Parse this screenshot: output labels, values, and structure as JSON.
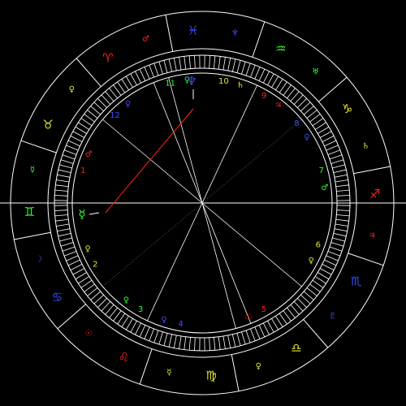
{
  "colors": {
    "background": "#000000",
    "lines": "#ffffff",
    "aspect_line": "#888888",
    "red": "#ff2020",
    "green": "#30ff30",
    "yellow": "#e6e630",
    "blue": "#3b4dff"
  },
  "zodiac_signs": [
    {
      "glyph": "♈",
      "color": "#ff2020"
    },
    {
      "glyph": "♉",
      "color": "#e6e630"
    },
    {
      "glyph": "♊",
      "color": "#30ff30"
    },
    {
      "glyph": "♋",
      "color": "#3b4dff"
    },
    {
      "glyph": "♌",
      "color": "#ff2020"
    },
    {
      "glyph": "♍",
      "color": "#e6e630"
    },
    {
      "glyph": "♎",
      "color": "#e6e630"
    },
    {
      "glyph": "♏",
      "color": "#3b4dff"
    },
    {
      "glyph": "♐",
      "color": "#ff2020"
    },
    {
      "glyph": "♑",
      "color": "#e6e630"
    },
    {
      "glyph": "♒",
      "color": "#30ff30"
    },
    {
      "glyph": "♓",
      "color": "#3b4dff"
    }
  ],
  "sign_rulers": [
    {
      "glyph": "♂",
      "color": "#ff2020"
    },
    {
      "glyph": "♀",
      "color": "#e6e630"
    },
    {
      "glyph": "☿",
      "color": "#30ff30"
    },
    {
      "glyph": "☽",
      "color": "#3b4dff"
    },
    {
      "glyph": "☉",
      "color": "#ff2020"
    },
    {
      "glyph": "☿",
      "color": "#e6e630"
    },
    {
      "glyph": "♀",
      "color": "#e6e630"
    },
    {
      "glyph": "♇",
      "color": "#3b4dff"
    },
    {
      "glyph": "♃",
      "color": "#ff2020"
    },
    {
      "glyph": "♄",
      "color": "#e6e630"
    },
    {
      "glyph": "♅",
      "color": "#30ff30"
    },
    {
      "glyph": "♆",
      "color": "#3b4dff"
    }
  ],
  "houses": [
    {
      "number": "1",
      "color": "#ff2020"
    },
    {
      "number": "2",
      "color": "#e6e630"
    },
    {
      "number": "3",
      "color": "#30ff30"
    },
    {
      "number": "4",
      "color": "#3b4dff"
    },
    {
      "number": "5",
      "color": "#ff2020"
    },
    {
      "number": "6",
      "color": "#e6e630"
    },
    {
      "number": "7",
      "color": "#30ff30"
    },
    {
      "number": "8",
      "color": "#3b4dff"
    },
    {
      "number": "9",
      "color": "#ff2020"
    },
    {
      "number": "10",
      "color": "#e6e630"
    },
    {
      "number": "11",
      "color": "#30ff30"
    },
    {
      "number": "12",
      "color": "#3b4dff"
    }
  ],
  "house_rulers": [
    {
      "glyph": "♂",
      "color": "#ff2020"
    },
    {
      "glyph": "♀",
      "color": "#e6e630"
    },
    {
      "glyph": "♀",
      "color": "#30ff30"
    },
    {
      "glyph": "♀",
      "color": "#3b4dff"
    },
    {
      "glyph": "☉",
      "color": "#ff2020"
    },
    {
      "glyph": "♀",
      "color": "#e6e630"
    },
    {
      "glyph": "♂",
      "color": "#30ff30"
    },
    {
      "glyph": "♀",
      "color": "#3b4dff"
    },
    {
      "glyph": "♃",
      "color": "#ff2020"
    },
    {
      "glyph": "♄",
      "color": "#e6e630"
    },
    {
      "glyph": "♀",
      "color": "#30ff30"
    },
    {
      "glyph": "♀",
      "color": "#3b4dff"
    }
  ],
  "planets": [
    {
      "glyph": "♆",
      "color": "#3b4dff"
    },
    {
      "glyph": "☿",
      "color": "#30ff30"
    }
  ]
}
